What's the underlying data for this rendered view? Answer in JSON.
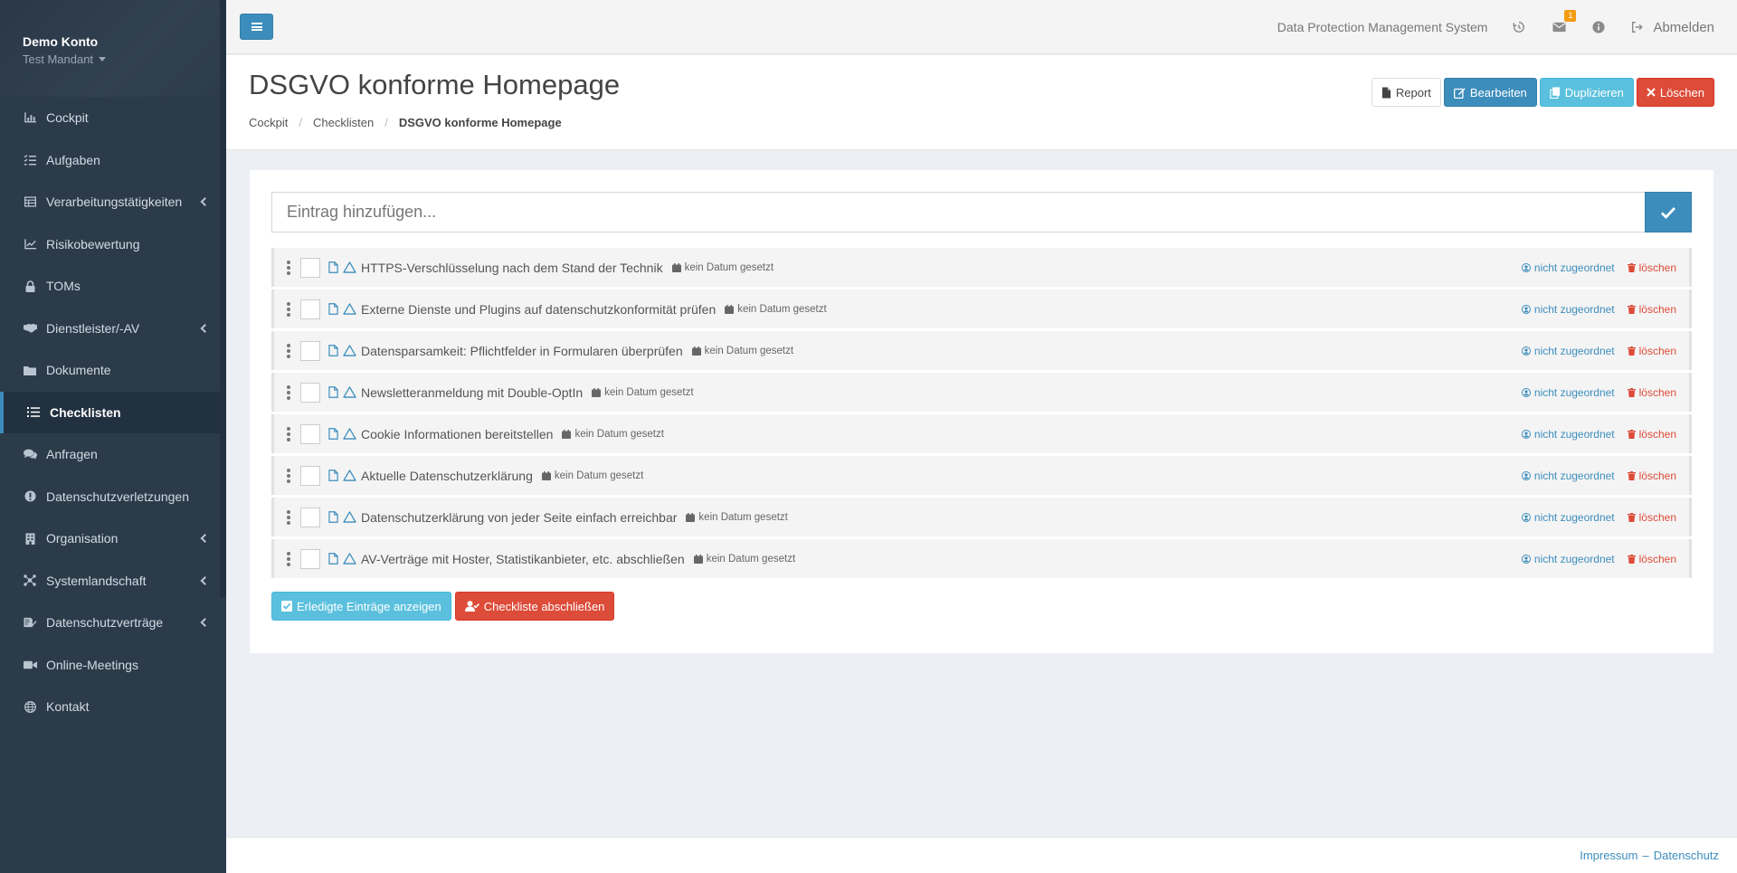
{
  "sidebar": {
    "account_name": "Demo Konto",
    "tenant": "Test Mandant",
    "items": [
      {
        "label": "Cockpit",
        "icon": "chart-icon",
        "has_children": false
      },
      {
        "label": "Aufgaben",
        "icon": "tasks-icon",
        "has_children": false
      },
      {
        "label": "Verarbeitungstätigkeiten",
        "icon": "table-icon",
        "has_children": true
      },
      {
        "label": "Risikobewertung",
        "icon": "line-chart-icon",
        "has_children": false
      },
      {
        "label": "TOMs",
        "icon": "lock-icon",
        "has_children": false
      },
      {
        "label": "Dienstleister/-AV",
        "icon": "handshake-icon",
        "has_children": true
      },
      {
        "label": "Dokumente",
        "icon": "folder-icon",
        "has_children": false
      },
      {
        "label": "Checklisten",
        "icon": "list-icon",
        "has_children": false,
        "active": true
      },
      {
        "label": "Anfragen",
        "icon": "comments-icon",
        "has_children": false
      },
      {
        "label": "Datenschutzverletzungen",
        "icon": "exclamation-icon",
        "has_children": false
      },
      {
        "label": "Organisation",
        "icon": "building-icon",
        "has_children": true
      },
      {
        "label": "Systemlandschaft",
        "icon": "network-icon",
        "has_children": true
      },
      {
        "label": "Datenschutzverträge",
        "icon": "contract-icon",
        "has_children": true
      },
      {
        "label": "Online-Meetings",
        "icon": "video-icon",
        "has_children": false
      },
      {
        "label": "Kontakt",
        "icon": "globe-icon",
        "has_children": false
      }
    ]
  },
  "topbar": {
    "system_name": "Data Protection Management System",
    "notification_count": "1",
    "logout_label": "Abmelden"
  },
  "header": {
    "title": "DSGVO konforme Homepage",
    "breadcrumb": [
      "Cockpit",
      "Checklisten",
      "DSGVO konforme Homepage"
    ],
    "actions": {
      "report": "Report",
      "edit": "Bearbeiten",
      "duplicate": "Duplizieren",
      "delete": "Löschen"
    }
  },
  "checklist": {
    "add_placeholder": "Eintrag hinzufügen...",
    "items": [
      {
        "text": "HTTPS-Verschlüsselung nach dem Stand der Technik",
        "date": "kein Datum gesetzt",
        "assignee": "nicht zugeordnet",
        "delete": "löschen"
      },
      {
        "text": "Externe Dienste und Plugins auf datenschutzkonformität prüfen",
        "date": "kein Datum gesetzt",
        "assignee": "nicht zugeordnet",
        "delete": "löschen"
      },
      {
        "text": "Datensparsamkeit: Pflichtfelder in Formularen überprüfen",
        "date": "kein Datum gesetzt",
        "assignee": "nicht zugeordnet",
        "delete": "löschen"
      },
      {
        "text": "Newsletteranmeldung mit Double-OptIn",
        "date": "kein Datum gesetzt",
        "assignee": "nicht zugeordnet",
        "delete": "löschen"
      },
      {
        "text": "Cookie Informationen bereitstellen",
        "date": "kein Datum gesetzt",
        "assignee": "nicht zugeordnet",
        "delete": "löschen"
      },
      {
        "text": "Aktuelle Datenschutzerklärung",
        "date": "kein Datum gesetzt",
        "assignee": "nicht zugeordnet",
        "delete": "löschen"
      },
      {
        "text": "Datenschutzerklärung von jeder Seite einfach erreichbar",
        "date": "kein Datum gesetzt",
        "assignee": "nicht zugeordnet",
        "delete": "löschen"
      },
      {
        "text": "AV-Verträge mit Hoster, Statistikanbieter, etc. abschließen",
        "date": "kein Datum gesetzt",
        "assignee": "nicht zugeordnet",
        "delete": "löschen"
      }
    ],
    "show_done": "Erledigte Einträge anzeigen",
    "close_checklist": "Checkliste abschließen"
  },
  "footer": {
    "impressum": "Impressum",
    "separator": "–",
    "datenschutz": "Datenschutz"
  },
  "colors": {
    "primary": "#3c8dbc",
    "info": "#5bc0de",
    "danger": "#dd4b39",
    "sidebar": "#2c3b4a",
    "badge": "#f39c12"
  }
}
